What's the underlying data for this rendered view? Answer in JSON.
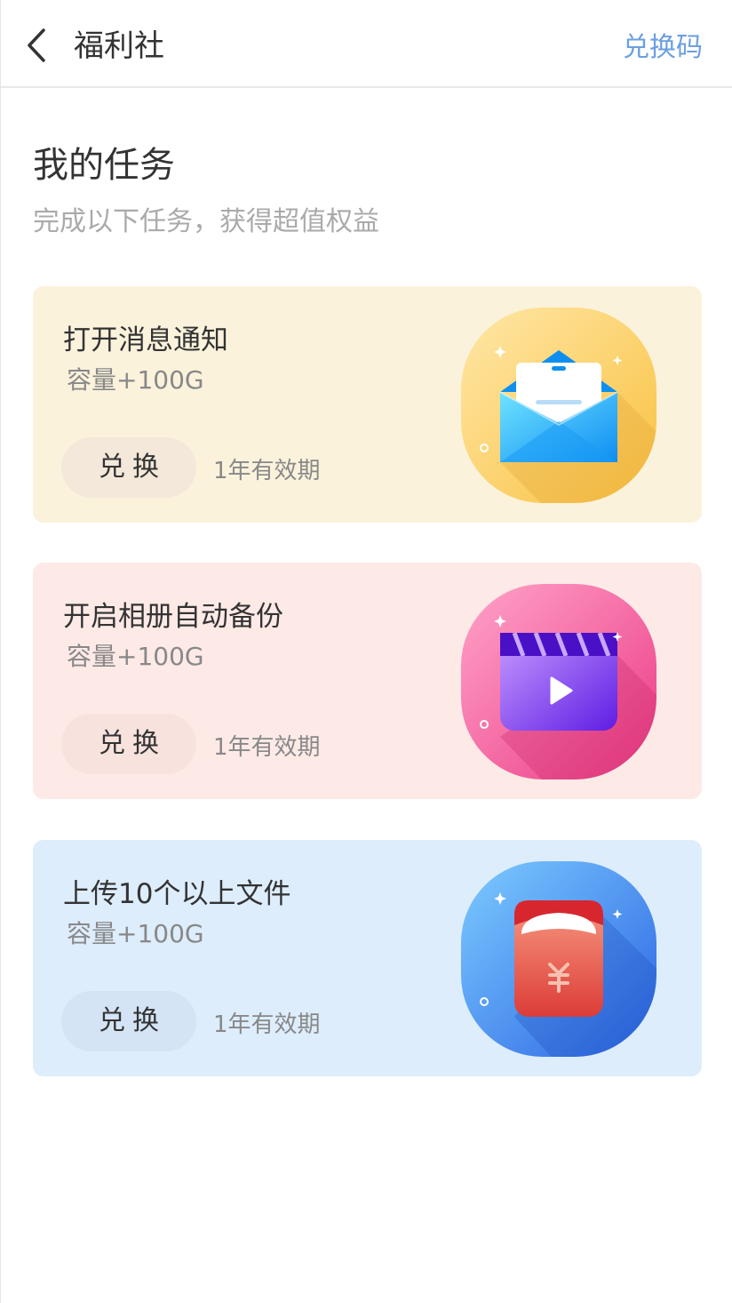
{
  "header": {
    "title": "福利社",
    "redeem_code_label": "兑换码"
  },
  "section": {
    "title": "我的任务",
    "subtitle": "完成以下任务，获得超值权益"
  },
  "tasks": [
    {
      "title": "打开消息通知",
      "reward": "容量+100G",
      "button_label": "兑换",
      "validity": "1年有效期",
      "icon": "envelope-icon",
      "accent": "#fbc84f"
    },
    {
      "title": "开启相册自动备份",
      "reward": "容量+100G",
      "button_label": "兑换",
      "validity": "1年有效期",
      "icon": "video-icon",
      "accent": "#f0458d"
    },
    {
      "title": "上传10个以上文件",
      "reward": "容量+100G",
      "button_label": "兑换",
      "validity": "1年有效期",
      "icon": "red-envelope-icon",
      "accent": "#3a80ea"
    }
  ],
  "colors": {
    "link": "#6b9fe0",
    "card_1_bg": "#fbf2dc",
    "card_2_bg": "#fdeae6",
    "card_3_bg": "#ddedfc"
  }
}
